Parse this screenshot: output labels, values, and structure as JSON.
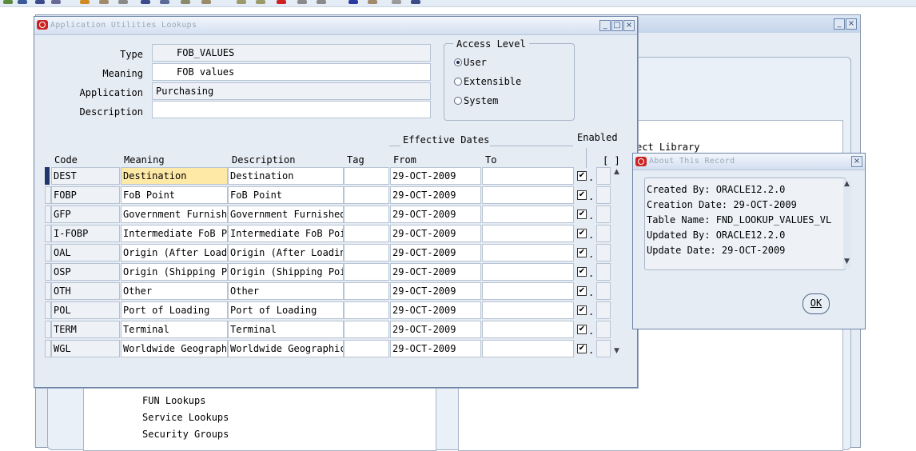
{
  "dialog": {
    "title": "Application Utilities Lookups",
    "form": {
      "type_label": "Type",
      "type_value": "FOB_VALUES",
      "meaning_label": "Meaning",
      "meaning_value": "FOB values",
      "application_label": "Application",
      "application_value": "Purchasing",
      "description_label": "Description",
      "description_value": ""
    },
    "access_level": {
      "title": "Access Level",
      "options": [
        {
          "label": "User",
          "selected": true
        },
        {
          "label": "Extensible",
          "selected": false
        },
        {
          "label": "System",
          "selected": false
        }
      ]
    },
    "effective_dates_label": "Effective Dates",
    "enabled_label": "Enabled",
    "bracket_label": "[ ]",
    "columns": {
      "code": "Code",
      "meaning": "Meaning",
      "description": "Description",
      "tag": "Tag",
      "from": "From",
      "to": "To"
    },
    "rows": [
      {
        "code": "DEST",
        "meaning": "Destination",
        "description": "Destination",
        "tag": "",
        "from": "29-OCT-2009",
        "to": "",
        "enabled": true
      },
      {
        "code": "FOBP",
        "meaning": "FoB Point",
        "description": "FoB Point",
        "tag": "",
        "from": "29-OCT-2009",
        "to": "",
        "enabled": true
      },
      {
        "code": "GFP",
        "meaning": "Government Furnishe",
        "description": "Government Furnished",
        "tag": "",
        "from": "29-OCT-2009",
        "to": "",
        "enabled": true
      },
      {
        "code": "I-FOBP",
        "meaning": "Intermediate FoB Po",
        "description": "Intermediate FoB Poi",
        "tag": "",
        "from": "29-OCT-2009",
        "to": "",
        "enabled": true
      },
      {
        "code": "OAL",
        "meaning": "Origin (After Loadi",
        "description": "Origin (After Loadin",
        "tag": "",
        "from": "29-OCT-2009",
        "to": "",
        "enabled": true
      },
      {
        "code": "OSP",
        "meaning": "Origin (Shipping Po",
        "description": "Origin (Shipping Poi",
        "tag": "",
        "from": "29-OCT-2009",
        "to": "",
        "enabled": true
      },
      {
        "code": "OTH",
        "meaning": "Other",
        "description": "Other",
        "tag": "",
        "from": "29-OCT-2009",
        "to": "",
        "enabled": true
      },
      {
        "code": "POL",
        "meaning": "Port of Loading",
        "description": "Port of Loading",
        "tag": "",
        "from": "29-OCT-2009",
        "to": "",
        "enabled": true
      },
      {
        "code": "TERM",
        "meaning": "Terminal",
        "description": "Terminal",
        "tag": "",
        "from": "29-OCT-2009",
        "to": "",
        "enabled": true
      },
      {
        "code": "WGL",
        "meaning": "Worldwide Geographi",
        "description": "Worldwide Geographic",
        "tag": "",
        "from": "29-OCT-2009",
        "to": "",
        "enabled": true
      }
    ]
  },
  "background": {
    "visible_text_1": "ect Library",
    "nav_items": [
      "FUN Lookups",
      "Service Lookups",
      "Security Groups"
    ]
  },
  "about": {
    "title": "About This Record",
    "lines": [
      "Created By:  ORACLE12.2.0",
      "Creation Date:  29-OCT-2009",
      "Table Name:  FND_LOOKUP_VALUES_VL",
      "Updated By:  ORACLE12.2.0",
      "Update Date:  29-OCT-2009"
    ],
    "ok_label": "OK"
  },
  "colors": {
    "oracle_red": "#cc2222",
    "selected_row": "#23356c",
    "highlight_cell": "#ffe9a6",
    "window_bg": "#e6ecf4"
  }
}
